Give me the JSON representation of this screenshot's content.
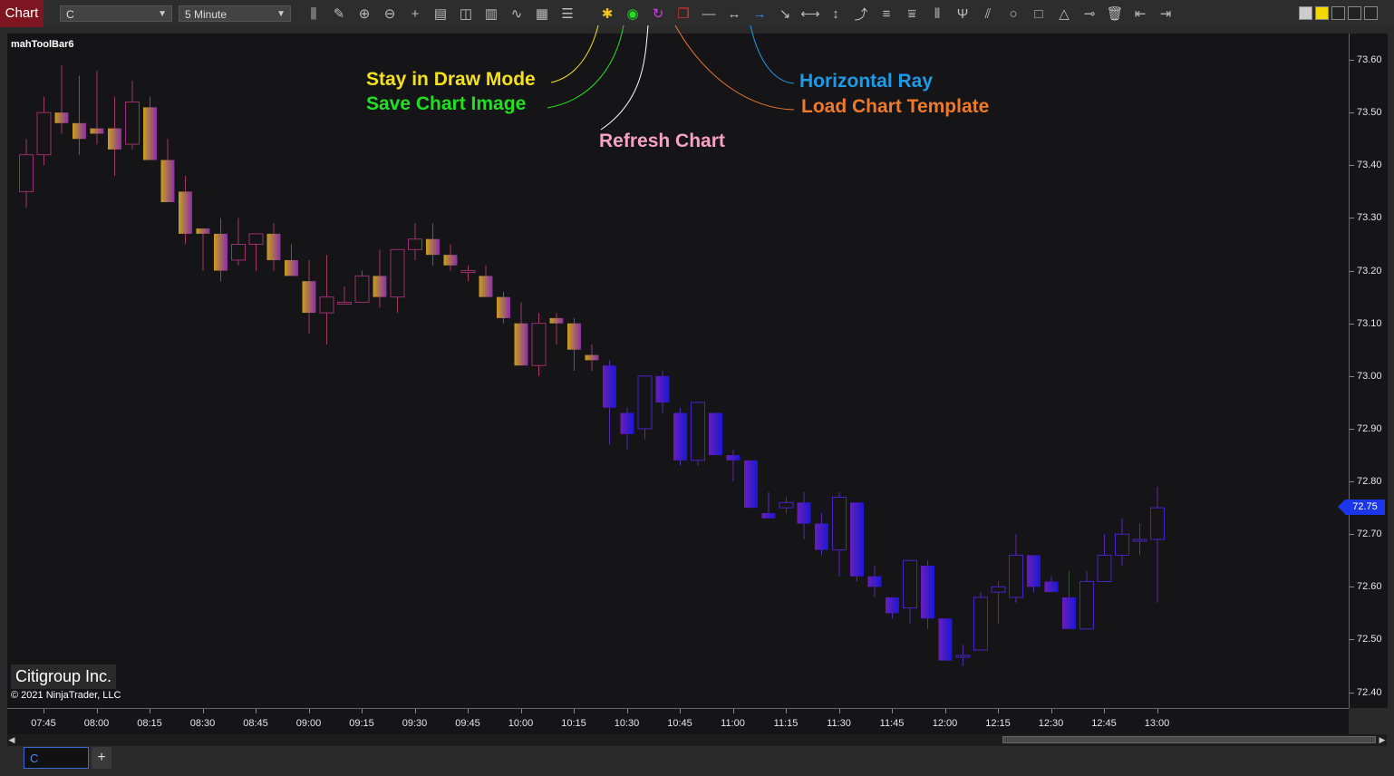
{
  "toolbar": {
    "chart_tab": "Chart",
    "instrument": "C",
    "interval": "5 Minute",
    "icons": [
      "bar-type",
      "pencil",
      "zoom-in",
      "zoom-out",
      "crosshair",
      "properties",
      "data-box",
      "indicators",
      "strategies",
      "chart-trader",
      "list",
      "stay-in-draw-mode",
      "save-chart-image",
      "refresh-chart",
      "load-chart-template",
      "line",
      "extended-line",
      "horizontal-ray",
      "ray",
      "horizontal-line",
      "vertical-line",
      "arrow-line",
      "fib-retracement",
      "fib-extension",
      "fib-time",
      "andrews-pitchfork",
      "parallel-channel",
      "ellipse",
      "rectangle",
      "triangle",
      "ruler",
      "remove-drawing",
      "scroll-left",
      "scroll-right"
    ]
  },
  "chart": {
    "toolbar_name": "mahToolBar6",
    "instrument_name": "Citigroup Inc.",
    "copyright": "© 2021 NinjaTrader, LLC",
    "last_price": "72.75"
  },
  "annotations": {
    "draw_mode": "Stay in Draw Mode",
    "save_image": "Save Chart Image",
    "refresh": "Refresh Chart",
    "horizontal_ray": "Horizontal Ray",
    "load_template": "Load Chart Template",
    "colors": {
      "draw_mode": "#f5e01e",
      "save_image": "#21e021",
      "refresh": "#f4a3c4",
      "horizontal_ray": "#1e9be6",
      "load_template": "#f07a2a"
    }
  },
  "bottom": {
    "tab_label": "C",
    "add_tab": "+"
  },
  "chart_data": {
    "type": "candlestick",
    "x_labels": [
      "07:45",
      "08:00",
      "08:15",
      "08:30",
      "08:45",
      "09:00",
      "09:15",
      "09:30",
      "09:45",
      "10:00",
      "10:15",
      "10:30",
      "10:45",
      "11:00",
      "11:15",
      "11:30",
      "11:45",
      "12:00",
      "12:15",
      "12:30",
      "12:45",
      "13:00"
    ],
    "y_labels": [
      "73.60",
      "73.50",
      "73.40",
      "73.30",
      "73.20",
      "73.10",
      "73.00",
      "72.90",
      "72.80",
      "72.70",
      "72.60",
      "72.50",
      "72.40"
    ],
    "ylim": [
      72.37,
      73.65
    ],
    "candles": [
      {
        "o": 73.35,
        "h": 73.45,
        "l": 73.32,
        "c": 73.42
      },
      {
        "o": 73.42,
        "h": 73.53,
        "l": 73.4,
        "c": 73.5
      },
      {
        "o": 73.5,
        "h": 73.59,
        "l": 73.46,
        "c": 73.48
      },
      {
        "o": 73.48,
        "h": 73.57,
        "l": 73.42,
        "c": 73.45
      },
      {
        "o": 73.47,
        "h": 73.58,
        "l": 73.44,
        "c": 73.46
      },
      {
        "o": 73.47,
        "h": 73.53,
        "l": 73.38,
        "c": 73.43
      },
      {
        "o": 73.44,
        "h": 73.56,
        "l": 73.43,
        "c": 73.52
      },
      {
        "o": 73.51,
        "h": 73.53,
        "l": 73.41,
        "c": 73.41
      },
      {
        "o": 73.41,
        "h": 73.45,
        "l": 73.33,
        "c": 73.33
      },
      {
        "o": 73.35,
        "h": 73.38,
        "l": 73.25,
        "c": 73.27
      },
      {
        "o": 73.28,
        "h": 73.28,
        "l": 73.2,
        "c": 73.27
      },
      {
        "o": 73.27,
        "h": 73.3,
        "l": 73.18,
        "c": 73.2
      },
      {
        "o": 73.22,
        "h": 73.3,
        "l": 73.21,
        "c": 73.25
      },
      {
        "o": 73.25,
        "h": 73.27,
        "l": 73.2,
        "c": 73.27
      },
      {
        "o": 73.27,
        "h": 73.29,
        "l": 73.2,
        "c": 73.22
      },
      {
        "o": 73.22,
        "h": 73.25,
        "l": 73.2,
        "c": 73.19
      },
      {
        "o": 73.18,
        "h": 73.22,
        "l": 73.08,
        "c": 73.12
      },
      {
        "o": 73.12,
        "h": 73.23,
        "l": 73.06,
        "c": 73.15
      },
      {
        "o": 73.14,
        "h": 73.17,
        "l": 73.14,
        "c": 73.14
      },
      {
        "o": 73.14,
        "h": 73.2,
        "l": 73.14,
        "c": 73.19
      },
      {
        "o": 73.19,
        "h": 73.24,
        "l": 73.13,
        "c": 73.15
      },
      {
        "o": 73.15,
        "h": 73.24,
        "l": 73.12,
        "c": 73.24
      },
      {
        "o": 73.24,
        "h": 73.29,
        "l": 73.22,
        "c": 73.26
      },
      {
        "o": 73.26,
        "h": 73.29,
        "l": 73.21,
        "c": 73.23
      },
      {
        "o": 73.23,
        "h": 73.25,
        "l": 73.2,
        "c": 73.21
      },
      {
        "o": 73.2,
        "h": 73.21,
        "l": 73.18,
        "c": 73.2
      },
      {
        "o": 73.19,
        "h": 73.21,
        "l": 73.15,
        "c": 73.15
      },
      {
        "o": 73.15,
        "h": 73.16,
        "l": 73.1,
        "c": 73.11
      },
      {
        "o": 73.1,
        "h": 73.14,
        "l": 73.02,
        "c": 73.02
      },
      {
        "o": 73.02,
        "h": 73.12,
        "l": 73.0,
        "c": 73.1
      },
      {
        "o": 73.11,
        "h": 73.12,
        "l": 73.06,
        "c": 73.1
      },
      {
        "o": 73.1,
        "h": 73.11,
        "l": 73.01,
        "c": 73.05
      },
      {
        "o": 73.04,
        "h": 73.06,
        "l": 73.01,
        "c": 73.03
      },
      {
        "o": 73.02,
        "h": 73.03,
        "l": 72.87,
        "c": 72.94
      },
      {
        "o": 72.93,
        "h": 72.94,
        "l": 72.86,
        "c": 72.89
      },
      {
        "o": 72.9,
        "h": 73.0,
        "l": 72.88,
        "c": 73.0
      },
      {
        "o": 73.0,
        "h": 73.01,
        "l": 72.93,
        "c": 72.95
      },
      {
        "o": 72.93,
        "h": 72.94,
        "l": 72.83,
        "c": 72.84
      },
      {
        "o": 72.84,
        "h": 72.95,
        "l": 72.83,
        "c": 72.95
      },
      {
        "o": 72.93,
        "h": 72.93,
        "l": 72.85,
        "c": 72.85
      },
      {
        "o": 72.85,
        "h": 72.86,
        "l": 72.8,
        "c": 72.84
      },
      {
        "o": 72.84,
        "h": 72.84,
        "l": 72.75,
        "c": 72.75
      },
      {
        "o": 72.74,
        "h": 72.78,
        "l": 72.73,
        "c": 72.73
      },
      {
        "o": 72.75,
        "h": 72.77,
        "l": 72.74,
        "c": 72.76
      },
      {
        "o": 72.76,
        "h": 72.78,
        "l": 72.69,
        "c": 72.72
      },
      {
        "o": 72.72,
        "h": 72.74,
        "l": 72.66,
        "c": 72.67
      },
      {
        "o": 72.67,
        "h": 72.78,
        "l": 72.62,
        "c": 72.77
      },
      {
        "o": 72.76,
        "h": 72.76,
        "l": 72.61,
        "c": 72.62
      },
      {
        "o": 72.62,
        "h": 72.64,
        "l": 72.58,
        "c": 72.6
      },
      {
        "o": 72.58,
        "h": 72.58,
        "l": 72.54,
        "c": 72.55
      },
      {
        "o": 72.56,
        "h": 72.65,
        "l": 72.53,
        "c": 72.65
      },
      {
        "o": 72.64,
        "h": 72.65,
        "l": 72.52,
        "c": 72.54
      },
      {
        "o": 72.54,
        "h": 72.54,
        "l": 72.48,
        "c": 72.46
      },
      {
        "o": 72.47,
        "h": 72.49,
        "l": 72.45,
        "c": 72.47
      },
      {
        "o": 72.48,
        "h": 72.59,
        "l": 72.48,
        "c": 72.58
      },
      {
        "o": 72.59,
        "h": 72.61,
        "l": 72.53,
        "c": 72.6
      },
      {
        "o": 72.58,
        "h": 72.7,
        "l": 72.57,
        "c": 72.66
      },
      {
        "o": 72.66,
        "h": 72.66,
        "l": 72.59,
        "c": 72.6
      },
      {
        "o": 72.61,
        "h": 72.62,
        "l": 72.59,
        "c": 72.59
      },
      {
        "o": 72.58,
        "h": 72.63,
        "l": 72.52,
        "c": 72.52
      },
      {
        "o": 72.52,
        "h": 72.63,
        "l": 72.52,
        "c": 72.61
      },
      {
        "o": 72.61,
        "h": 72.7,
        "l": 72.61,
        "c": 72.66
      },
      {
        "o": 72.66,
        "h": 72.73,
        "l": 72.64,
        "c": 72.7
      },
      {
        "o": 72.69,
        "h": 72.72,
        "l": 72.66,
        "c": 72.69
      },
      {
        "o": 72.69,
        "h": 72.79,
        "l": 72.57,
        "c": 72.75
      }
    ]
  }
}
